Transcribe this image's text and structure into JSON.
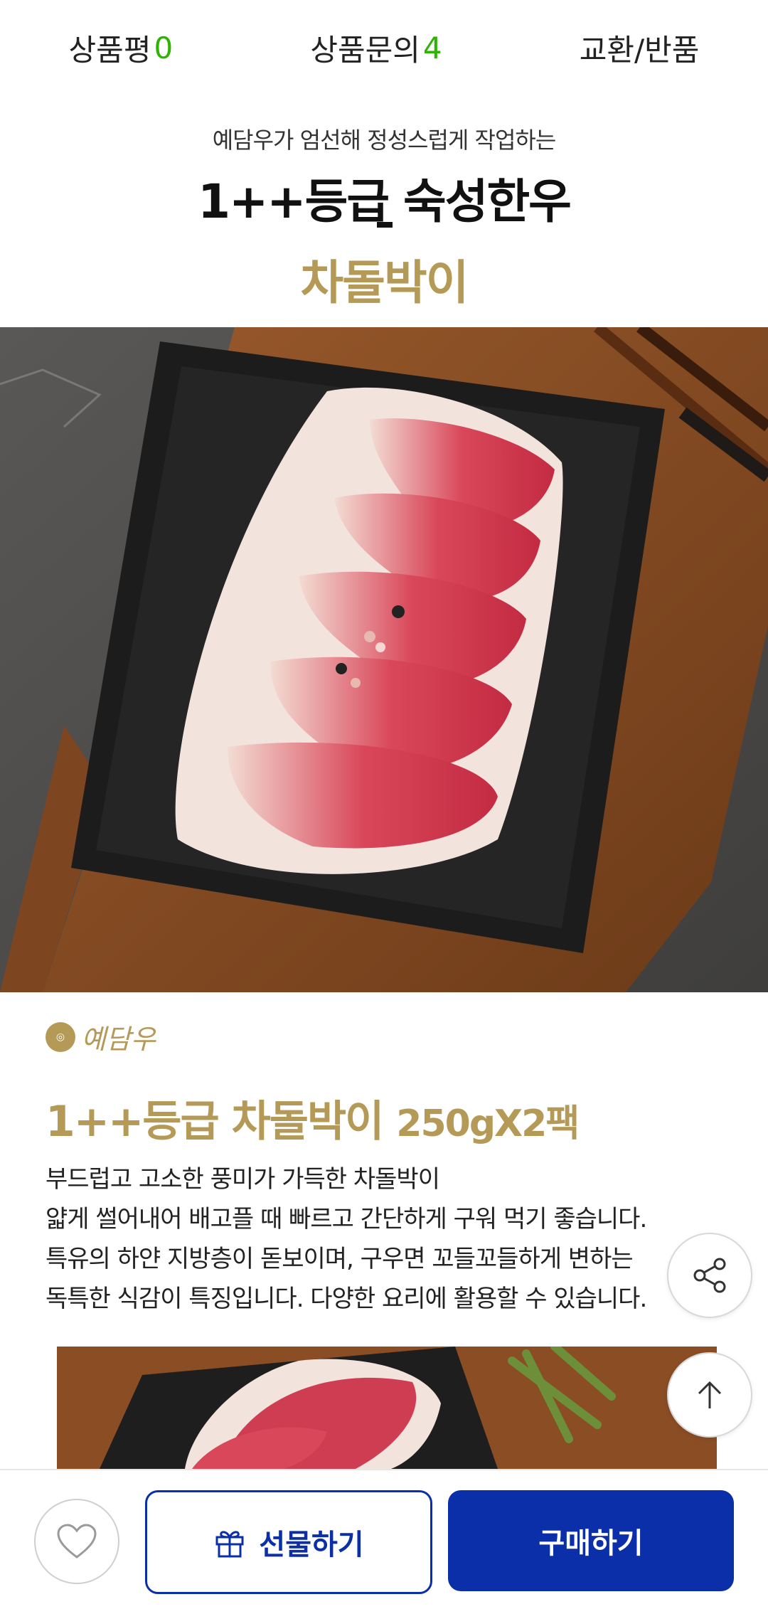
{
  "tabs": [
    {
      "label": "상품평",
      "count": "0"
    },
    {
      "label": "상품문의",
      "count": "4"
    },
    {
      "label": "교환/반품",
      "count": ""
    }
  ],
  "hero": {
    "intro": "예담우가 엄선해 정성스럽게 작업하는",
    "headline": "1++등급 숙성한우",
    "subhead": "차돌박이"
  },
  "brand": {
    "mark": "예담우",
    "name": "예담우"
  },
  "product": {
    "title_main": "1++등급 차돌박이",
    "title_size": "250gX2팩",
    "description": [
      "부드럽고 고소한 풍미가 가득한 차돌박이",
      "얇게 썰어내어  배고플 때 빠르고 간단하게 구워 먹기 좋습니다.",
      "특유의 하얀 지방층이 돋보이며, 구우면 꼬들꼬들하게 변하는",
      "독특한 식감이 특징입니다. 다양한 요리에 활용할 수 있습니다."
    ]
  },
  "actions": {
    "gift_label": "선물하기",
    "buy_label": "구매하기"
  },
  "colors": {
    "accent_gold": "#b59a57",
    "primary_blue": "#0b2fa8",
    "count_green": "#2db400"
  },
  "icons": [
    "heart-icon",
    "gift-icon",
    "share-icon",
    "arrow-up-icon"
  ]
}
